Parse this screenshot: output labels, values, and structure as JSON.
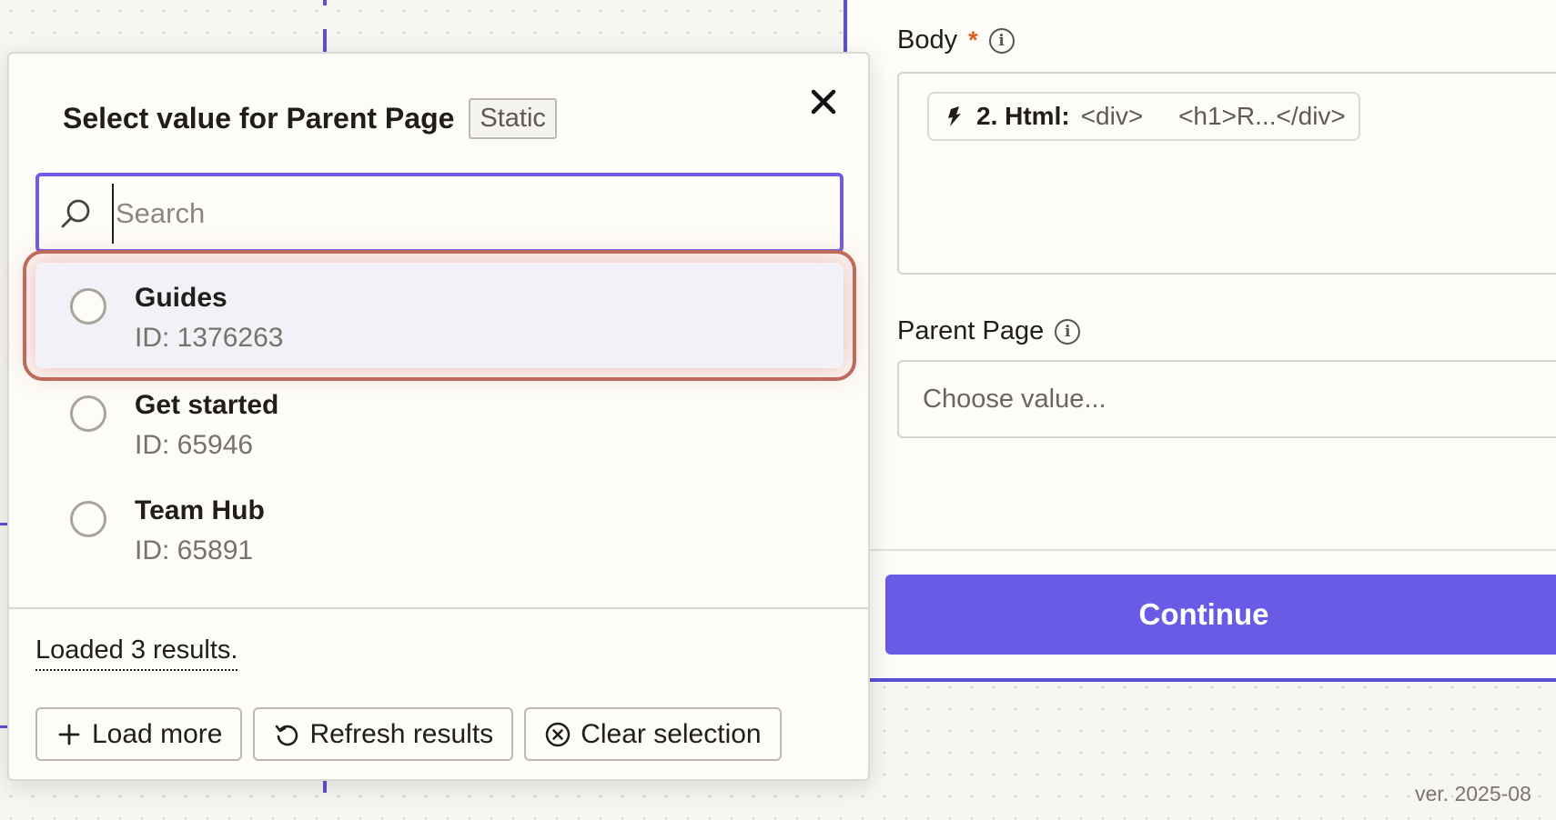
{
  "right_panel": {
    "body_label": "Body",
    "body_required_marker": "*",
    "body_pill": {
      "step": "2. Html:",
      "value": "<div>     <h1>R...</div>"
    },
    "parent_page_label": "Parent Page",
    "parent_page_placeholder": "Choose value...",
    "continue_label": "Continue",
    "version": "ver. 2025-08"
  },
  "modal": {
    "title": "Select value for Parent Page",
    "badge": "Static",
    "search_placeholder": "Search",
    "options": [
      {
        "name": "Guides",
        "id": "ID: 1376263",
        "highlighted": true
      },
      {
        "name": "Get started",
        "id": "ID: 65946",
        "highlighted": false
      },
      {
        "name": "Team Hub",
        "id": "ID: 65891",
        "highlighted": false
      }
    ],
    "status": "Loaded 3 results.",
    "buttons": {
      "load_more": "Load more",
      "refresh": "Refresh results",
      "clear": "Clear selection"
    }
  },
  "colors": {
    "accent": "#6c5ce7",
    "continue_bg": "#695be6",
    "highlight_outline": "#c06a5e",
    "required": "#e05a1b"
  }
}
